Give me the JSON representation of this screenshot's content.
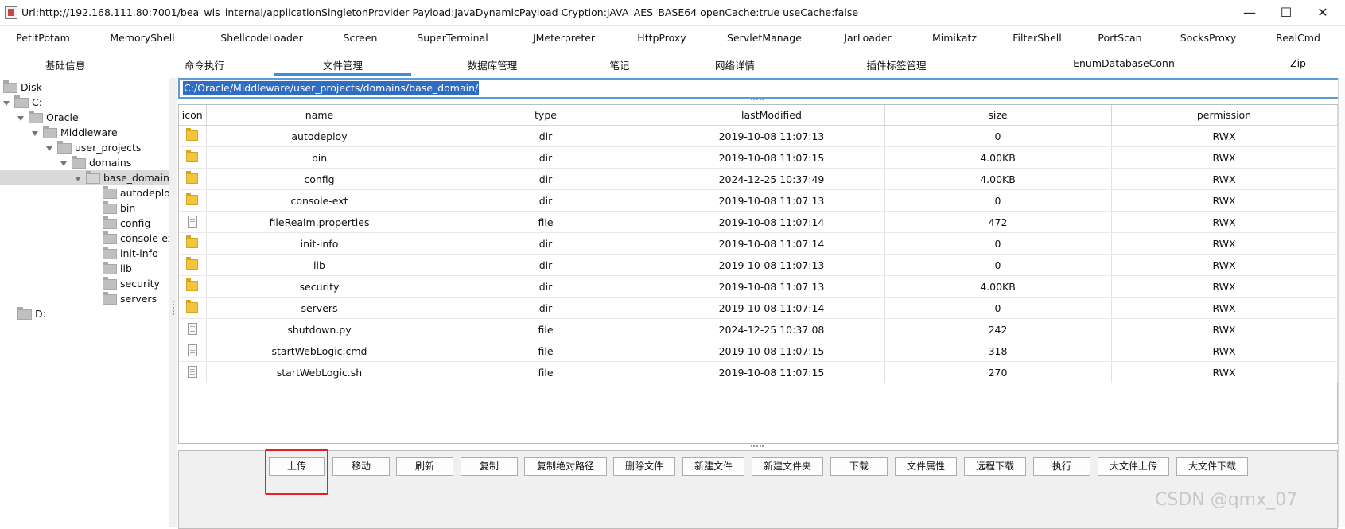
{
  "window": {
    "title": "Url:http://192.168.111.80:7001/bea_wls_internal/applicationSingletonProvider Payload:JavaDynamicPayload Cryption:JAVA_AES_BASE64 openCache:true useCache:false",
    "controls": [
      "—",
      "☐",
      "✕"
    ]
  },
  "plugins": [
    "PetitPotam",
    "MemoryShell",
    "ShellcodeLoader",
    "Screen",
    "SuperTerminal",
    "JMeterpreter",
    "HttpProxy",
    "ServletManage",
    "JarLoader",
    "Mimikatz",
    "FilterShell",
    "PortScan",
    "SocksProxy",
    "RealCmd"
  ],
  "tabs": [
    "基础信息",
    "命令执行",
    "文件管理",
    "数据库管理",
    "笔记",
    "网络详情",
    "插件标签管理",
    "EnumDatabaseConn",
    "Zip"
  ],
  "active_tab": "文件管理",
  "tree": [
    "Disk",
    "C:",
    "Oracle",
    "Middleware",
    "user_projects",
    "domains",
    "base_domain",
    "autodeploy",
    "bin",
    "config",
    "console-ext",
    "init-info",
    "lib",
    "security",
    "servers",
    "D:"
  ],
  "path": "C:/Oracle/Middleware/user_projects/domains/base_domain/",
  "table": {
    "columns": [
      "icon",
      "name",
      "type",
      "lastModified",
      "size",
      "permission"
    ],
    "rows": [
      {
        "icon": "folder-icon",
        "name": "autodeploy",
        "type": "dir",
        "lastModified": "2019-10-08 11:07:13",
        "size": "0",
        "permission": "RWX"
      },
      {
        "icon": "folder-icon",
        "name": "bin",
        "type": "dir",
        "lastModified": "2019-10-08 11:07:15",
        "size": "4.00KB",
        "permission": "RWX"
      },
      {
        "icon": "folder-icon",
        "name": "config",
        "type": "dir",
        "lastModified": "2024-12-25 10:37:49",
        "size": "4.00KB",
        "permission": "RWX"
      },
      {
        "icon": "folder-icon",
        "name": "console-ext",
        "type": "dir",
        "lastModified": "2019-10-08 11:07:13",
        "size": "0",
        "permission": "RWX"
      },
      {
        "icon": "file-icon",
        "name": "fileRealm.properties",
        "type": "file",
        "lastModified": "2019-10-08 11:07:14",
        "size": "472",
        "permission": "RWX"
      },
      {
        "icon": "folder-icon",
        "name": "init-info",
        "type": "dir",
        "lastModified": "2019-10-08 11:07:14",
        "size": "0",
        "permission": "RWX"
      },
      {
        "icon": "folder-icon",
        "name": "lib",
        "type": "dir",
        "lastModified": "2019-10-08 11:07:13",
        "size": "0",
        "permission": "RWX"
      },
      {
        "icon": "folder-icon",
        "name": "security",
        "type": "dir",
        "lastModified": "2019-10-08 11:07:13",
        "size": "4.00KB",
        "permission": "RWX"
      },
      {
        "icon": "folder-icon",
        "name": "servers",
        "type": "dir",
        "lastModified": "2019-10-08 11:07:14",
        "size": "0",
        "permission": "RWX"
      },
      {
        "icon": "file-icon",
        "name": "shutdown.py",
        "type": "file",
        "lastModified": "2024-12-25 10:37:08",
        "size": "242",
        "permission": "RWX"
      },
      {
        "icon": "file-icon",
        "name": "startWebLogic.cmd",
        "type": "file",
        "lastModified": "2019-10-08 11:07:15",
        "size": "318",
        "permission": "RWX"
      },
      {
        "icon": "file-icon",
        "name": "startWebLogic.sh",
        "type": "file",
        "lastModified": "2019-10-08 11:07:15",
        "size": "270",
        "permission": "RWX"
      }
    ]
  },
  "buttons": [
    "上传",
    "移动",
    "刷新",
    "复制",
    "复制绝对路径",
    "删除文件",
    "新建文件",
    "新建文件夹",
    "下载",
    "文件属性",
    "远程下载",
    "执行",
    "大文件上传",
    "大文件下载"
  ],
  "highlight_color": "#e52222",
  "watermark": "CSDN @qmx_07"
}
